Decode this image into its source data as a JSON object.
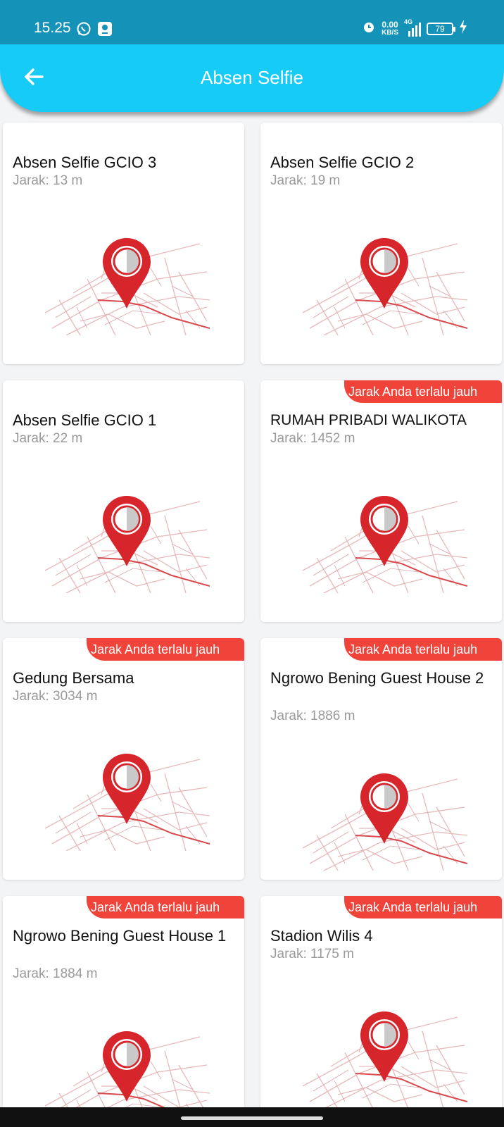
{
  "status_bar": {
    "time": "15.25",
    "speed_value": "0.00",
    "speed_unit": "KB/S",
    "network": "4G",
    "battery": "79",
    "icons": [
      "whatsapp-icon",
      "location-app-icon",
      "alarm-icon",
      "signal-icon",
      "battery-icon",
      "charging-icon"
    ]
  },
  "app_bar": {
    "title": "Absen Selfie",
    "back_icon": "arrow-left-icon",
    "color": "#16cbf5"
  },
  "colors": {
    "ribbon": "#f0433a",
    "pin": "#d7262b",
    "status_bar": "#1592b8"
  },
  "cards": [
    {
      "title": "Absen Selfie GCIO 3",
      "distance": "Jarak: 13 m",
      "ribbon": ""
    },
    {
      "title": "Absen Selfie GCIO 2",
      "distance": "Jarak: 19 m",
      "ribbon": ""
    },
    {
      "title": "Absen Selfie GCIO 1",
      "distance": "Jarak: 22 m",
      "ribbon": ""
    },
    {
      "title": "RUMAH PRIBADI WALIKOTA",
      "distance": "Jarak: 1452 m",
      "ribbon": "Jarak Anda terlalu jauh"
    },
    {
      "title": "Gedung Bersama",
      "distance": "Jarak: 3034 m",
      "ribbon": "Jarak Anda terlalu jauh"
    },
    {
      "title": "Ngrowo Bening Guest House 2",
      "distance": "Jarak: 1886 m",
      "ribbon": "Jarak Anda terlalu jauh"
    },
    {
      "title": "Ngrowo Bening Guest House 1",
      "distance": "Jarak: 1884 m",
      "ribbon": "Jarak Anda terlalu jauh"
    },
    {
      "title": "Stadion Wilis 4",
      "distance": "Jarak: 1175 m",
      "ribbon": "Jarak Anda terlalu jauh"
    }
  ]
}
